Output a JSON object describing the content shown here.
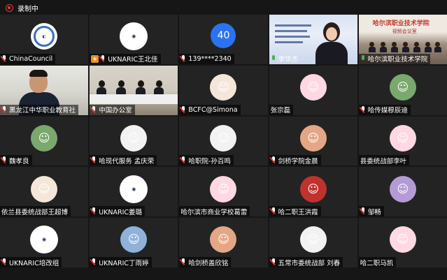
{
  "recording": {
    "label": "录制中"
  },
  "tiles": [
    {
      "name": "ChinaCouncil",
      "avatar": "ChinaCouncil logo",
      "avatar_class": "logo",
      "mic": "off",
      "host": false
    },
    {
      "name": "UKNARIC王北佳",
      "avatar": "UKNARIC China Centre",
      "avatar_class": "ukn",
      "mic": "off",
      "host": true
    },
    {
      "name": "139****2340",
      "avatar": "40",
      "avatar_class": "num",
      "mic": "off",
      "host": false
    },
    {
      "name": "李华杰",
      "avatar": "speaker-video",
      "avatar_class": "speaker",
      "mic": "on",
      "host": false,
      "plain_bar": true
    },
    {
      "name": "哈尔滨职业技术学院",
      "avatar": "room-video",
      "avatar_class": "room",
      "mic": "on",
      "host": false,
      "room_title": "哈尔滨职业技术学院",
      "room_sub": "视频会议室"
    },
    {
      "name": "黑龙江中华职业教育社",
      "avatar": "man-video",
      "avatar_class": "man",
      "mic": "off",
      "host": false
    },
    {
      "name": "中国办公室",
      "avatar": "meeting-video",
      "avatar_class": "meeting",
      "mic": "off",
      "host": false
    },
    {
      "name": "BCFC@Simona",
      "avatar": "red bird avatar",
      "avatar_class": "cartoon",
      "mic": "off",
      "host": false
    },
    {
      "name": "张宗磊",
      "avatar": "girl avatar",
      "avatar_class": "pink",
      "mic": "off",
      "host": false,
      "no_mic": true
    },
    {
      "name": "哈传媒穆辰迪",
      "avatar": "horse avatar",
      "avatar_class": "green",
      "mic": "off",
      "host": false
    },
    {
      "name": "魏孝良",
      "avatar": "landscape avatar",
      "avatar_class": "green",
      "mic": "off",
      "host": false
    },
    {
      "name": "哈现代服务  孟庆荣",
      "avatar": "school logo avatar",
      "avatar_class": "white",
      "mic": "off",
      "host": false
    },
    {
      "name": "哈职院-孙百鸣",
      "avatar": "cartoon boy avatar",
      "avatar_class": "white",
      "mic": "off",
      "host": false
    },
    {
      "name": "剑桥学院金晨",
      "avatar": "glasses girl avatar",
      "avatar_class": "warm",
      "mic": "off",
      "host": false
    },
    {
      "name": "县委统战部李叶",
      "avatar": "anime girl avatar",
      "avatar_class": "pink",
      "mic": "off",
      "host": false,
      "no_mic": true
    },
    {
      "name": "依兰县委统战部王超博",
      "avatar": "dog avatar",
      "avatar_class": "cartoon",
      "mic": "off",
      "host": false,
      "no_mic": true
    },
    {
      "name": "UKNARIC姜璐",
      "avatar": "UKNARIC China Centre",
      "avatar_class": "ukn",
      "mic": "off",
      "host": false
    },
    {
      "name": "哈尔滨市商业学校葛雷",
      "avatar": "flower avatar",
      "avatar_class": "pink",
      "mic": "off",
      "host": false,
      "no_mic": true
    },
    {
      "name": "哈二职王洪霞",
      "avatar": "red card avatar",
      "avatar_class": "red",
      "mic": "off",
      "host": false
    },
    {
      "name": "邹畅",
      "avatar": "flowers avatar",
      "avatar_class": "purple",
      "mic": "off",
      "host": false
    },
    {
      "name": "UKNARIC培改组",
      "avatar": "UKNARIC China Centre",
      "avatar_class": "ukn",
      "mic": "off",
      "host": false
    },
    {
      "name": "UKNARIC丁雨婷",
      "avatar": "gradient avatar",
      "avatar_class": "sky",
      "mic": "off",
      "host": false
    },
    {
      "name": "哈剑桥盖欣铭",
      "avatar": "girl photo avatar",
      "avatar_class": "warm",
      "mic": "off",
      "host": false
    },
    {
      "name": "五常市委统战部 刘春",
      "avatar": "man photo avatar",
      "avatar_class": "white",
      "mic": "off",
      "host": false
    },
    {
      "name": "哈二职马凯",
      "avatar": "cartoon girl avatar",
      "avatar_class": "pink",
      "mic": "off",
      "host": false,
      "no_mic": true
    }
  ]
}
